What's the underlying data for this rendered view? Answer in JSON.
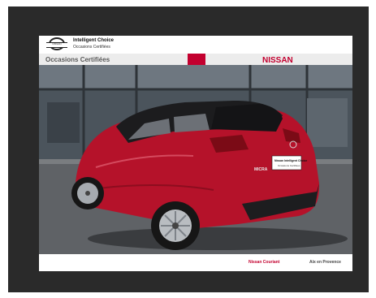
{
  "header": {
    "brand_badge": "NISSAN",
    "title": "Intelligent Choice",
    "subtitle": "Occasions Certifiées"
  },
  "scene": {
    "facade_sign_left": "Occasions Certifiées",
    "facade_sign_right": "NISSAN",
    "model_badge": "MICRA",
    "plate_line1": "Nissan Intelligent Choice",
    "plate_line2": "Occasions Certifiées"
  },
  "footer": {
    "dealer": "Nissan Couriant",
    "city": "Aix en Provence"
  },
  "colors": {
    "frame": "#2a2a2a",
    "car_red": "#b5122a",
    "brand_red": "#c3002f"
  }
}
